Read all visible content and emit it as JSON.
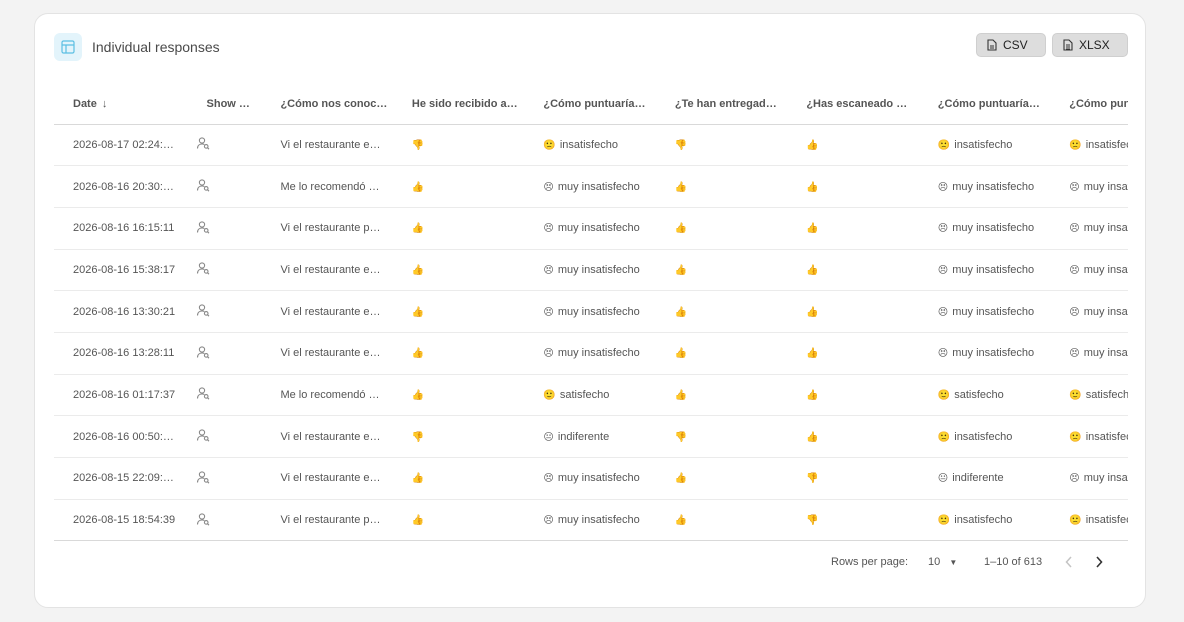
{
  "header": {
    "title": "Individual responses"
  },
  "export": {
    "csv_label": "CSV",
    "xlsx_label": "XLSX"
  },
  "table": {
    "columns": [
      "Date",
      "Show …",
      "¿Cómo nos conoc…",
      "He sido recibido a…",
      "¿Cómo puntuaría…",
      "¿Te han entregad…",
      "¿Has escaneado …",
      "¿Cómo puntuaría…",
      "¿Cómo puntuar"
    ],
    "rows": [
      {
        "date": "2026-08-17 02:24:…",
        "source": "Vi el restaurante e…",
        "received": "👎",
        "rating1_emoji": "🙁",
        "rating1": "insatisfecho",
        "delivered": "👎",
        "scanned": "👍",
        "rating2_emoji": "🙁",
        "rating2": "insatisfecho",
        "rating3_emoji": "🙁",
        "rating3": "insatisfecho"
      },
      {
        "date": "2026-08-16 20:30:…",
        "source": "Me lo recomendó …",
        "received": "👍",
        "rating1_emoji": "😣",
        "rating1": "muy insatisfecho",
        "delivered": "👍",
        "scanned": "👍",
        "rating2_emoji": "😣",
        "rating2": "muy insatisfecho",
        "rating3_emoji": "😣",
        "rating3": "muy insatisfecho"
      },
      {
        "date": "2026-08-16 16:15:11",
        "source": "Vi el restaurante p…",
        "received": "👍",
        "rating1_emoji": "😣",
        "rating1": "muy insatisfecho",
        "delivered": "👍",
        "scanned": "👍",
        "rating2_emoji": "😣",
        "rating2": "muy insatisfecho",
        "rating3_emoji": "😣",
        "rating3": "muy insatisfecho"
      },
      {
        "date": "2026-08-16 15:38:17",
        "source": "Vi el restaurante e…",
        "received": "👍",
        "rating1_emoji": "😣",
        "rating1": "muy insatisfecho",
        "delivered": "👍",
        "scanned": "👍",
        "rating2_emoji": "😣",
        "rating2": "muy insatisfecho",
        "rating3_emoji": "😣",
        "rating3": "muy insatisfecho"
      },
      {
        "date": "2026-08-16 13:30:21",
        "source": "Vi el restaurante e…",
        "received": "👍",
        "rating1_emoji": "😣",
        "rating1": "muy insatisfecho",
        "delivered": "👍",
        "scanned": "👍",
        "rating2_emoji": "😣",
        "rating2": "muy insatisfecho",
        "rating3_emoji": "😣",
        "rating3": "muy insatisfecho"
      },
      {
        "date": "2026-08-16 13:28:11",
        "source": "Vi el restaurante e…",
        "received": "👍",
        "rating1_emoji": "😣",
        "rating1": "muy insatisfecho",
        "delivered": "👍",
        "scanned": "👍",
        "rating2_emoji": "😣",
        "rating2": "muy insatisfecho",
        "rating3_emoji": "😣",
        "rating3": "muy insatisfecho"
      },
      {
        "date": "2026-08-16 01:17:37",
        "source": "Me lo recomendó …",
        "received": "👍",
        "rating1_emoji": "🙂",
        "rating1": "satisfecho",
        "delivered": "👍",
        "scanned": "👍",
        "rating2_emoji": "🙂",
        "rating2": "satisfecho",
        "rating3_emoji": "🙂",
        "rating3": "satisfecho"
      },
      {
        "date": "2026-08-16 00:50:…",
        "source": "Vi el restaurante e…",
        "received": "👎",
        "rating1_emoji": "😐",
        "rating1": "indiferente",
        "delivered": "👎",
        "scanned": "👍",
        "rating2_emoji": "🙁",
        "rating2": "insatisfecho",
        "rating3_emoji": "🙁",
        "rating3": "insatisfecho"
      },
      {
        "date": "2026-08-15 22:09:…",
        "source": "Vi el restaurante e…",
        "received": "👍",
        "rating1_emoji": "😣",
        "rating1": "muy insatisfecho",
        "delivered": "👍",
        "scanned": "👎",
        "rating2_emoji": "😐",
        "rating2": "indiferente",
        "rating3_emoji": "😣",
        "rating3": "muy insatisfecho"
      },
      {
        "date": "2026-08-15 18:54:39",
        "source": "Vi el restaurante p…",
        "received": "👍",
        "rating1_emoji": "😣",
        "rating1": "muy insatisfecho",
        "delivered": "👍",
        "scanned": "👎",
        "rating2_emoji": "🙁",
        "rating2": "insatisfecho",
        "rating3_emoji": "🙁",
        "rating3": "insatisfecho"
      }
    ]
  },
  "footer": {
    "rows_per_page_label": "Rows per page:",
    "rows_per_page_value": "10",
    "range_text": "1–10 of 613"
  },
  "icons": {
    "header": "table-icon",
    "csv": "csv-file-icon",
    "xlsx": "xlsx-file-icon",
    "row_action": "user-search-icon",
    "prev": "chevron-left-icon",
    "next": "chevron-right-icon",
    "sort": "arrow-down-icon",
    "rows_select": "caret-down-icon"
  },
  "colors": {
    "background": "#f3f3f3",
    "card": "#ffffff",
    "header_icon_bg": "#e3f4fb",
    "accent_icon": "#5bbfe3",
    "button_bg": "#dddddd"
  }
}
